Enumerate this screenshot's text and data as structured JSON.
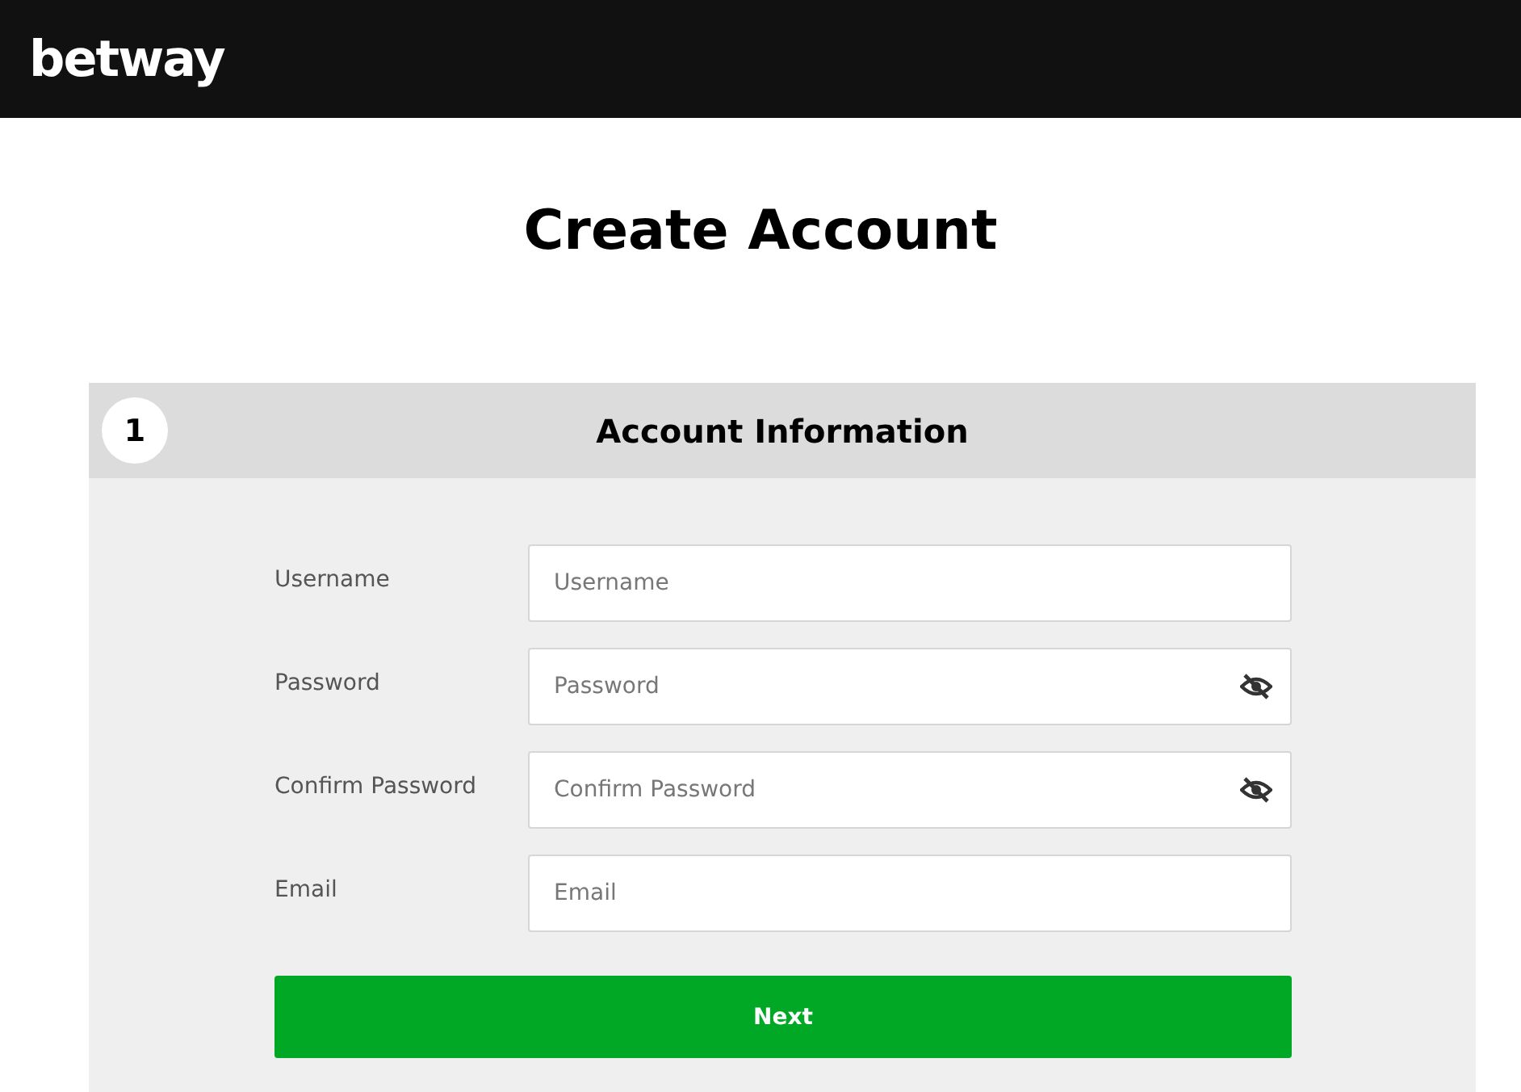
{
  "header": {
    "logo": "betway"
  },
  "title": "Create Account",
  "section": {
    "step": "1",
    "title": "Account Information",
    "fields": [
      {
        "label": "Username",
        "placeholder": "Username",
        "kind": "text"
      },
      {
        "label": "Password",
        "placeholder": "Password",
        "kind": "password"
      },
      {
        "label": "Confirm Password",
        "placeholder": "Confirm Password",
        "kind": "password"
      },
      {
        "label": "Email",
        "placeholder": "Email",
        "kind": "text"
      }
    ],
    "button": "Next"
  }
}
